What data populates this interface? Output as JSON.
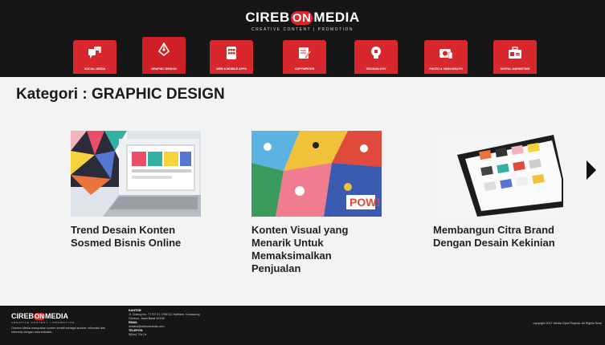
{
  "brand": {
    "name_left": "CIREB",
    "name_mid": "ON",
    "name_right": "MEDIA",
    "tagline": "CREATIVE CONTENT | PROMOTION"
  },
  "nav": {
    "items": [
      {
        "label": "SOCIAL MEDIA",
        "icon": "social-media-icon"
      },
      {
        "label": "GRAPHIC DESIGN",
        "icon": "pen-tool-icon",
        "active": true
      },
      {
        "label": "WEB & MOBILE APPS",
        "icon": "app-grid-icon"
      },
      {
        "label": "COPYWRITER",
        "icon": "document-edit-icon"
      },
      {
        "label": "TECHNOLOGY",
        "icon": "lightbulb-chip-icon"
      },
      {
        "label": "PHOTO & VIDEOGRAPH",
        "icon": "camera-icon"
      },
      {
        "label": "DIGITAL MARKETING",
        "icon": "briefcase-icon"
      }
    ]
  },
  "category": {
    "title": "Kategori : GRAPHIC DESIGN"
  },
  "articles": [
    {
      "title": "Trend Desain Konten Sosmed Bisnis Online"
    },
    {
      "title": "Konten Visual yang Menarik Untuk Memaksimalkan Penjualan"
    },
    {
      "title": "Membangun Citra Brand Dengan Desain Kekinian"
    }
  ],
  "footer": {
    "description": "Cirebon Media merupakan konten kreatif sebagai sumber informasi dan referensi dengan cara kekinian.",
    "office_heading": "KANTOR",
    "office_address": "Jl. Cideng No. 77 RT 01 / RW 02, Kalibaru, Kedawung",
    "office_city": "Cirebon, Jawa Barat 45156",
    "email_heading": "EMAIL",
    "email_value": "redaksi@ciebonmedia.com",
    "phone_heading": "TELEPON",
    "phone_value": "0(0xx) 70x-0x",
    "copyright": "copyright 2017 Media Cipta Regista. All Rights Rese"
  },
  "colors": {
    "header_bg": "#161616",
    "accent_red": "#d9282d",
    "page_bg": "#f3f3f3"
  }
}
